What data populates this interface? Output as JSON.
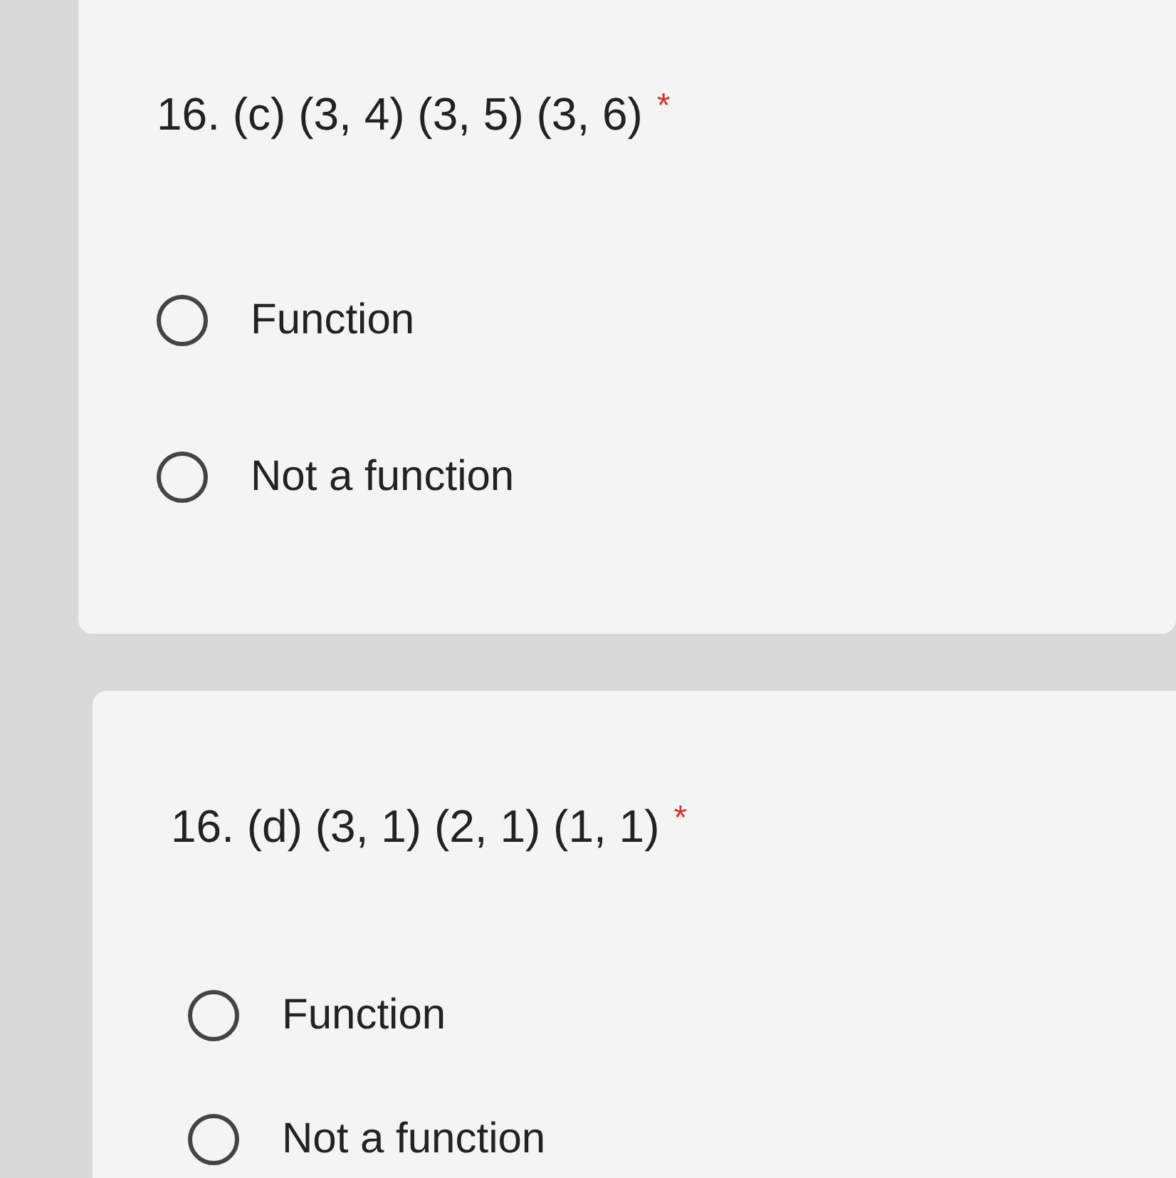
{
  "questions": [
    {
      "title": "16. (c) (3, 4) (3, 5) (3, 6)",
      "required_mark": "*",
      "options": [
        {
          "label": "Function",
          "selected": false
        },
        {
          "label": "Not a function",
          "selected": false
        }
      ]
    },
    {
      "title": "16. (d) (3, 1) (2, 1) (1, 1)",
      "required_mark": "*",
      "options": [
        {
          "label": "Function",
          "selected": false
        },
        {
          "label": "Not a function",
          "selected": false
        }
      ]
    }
  ]
}
